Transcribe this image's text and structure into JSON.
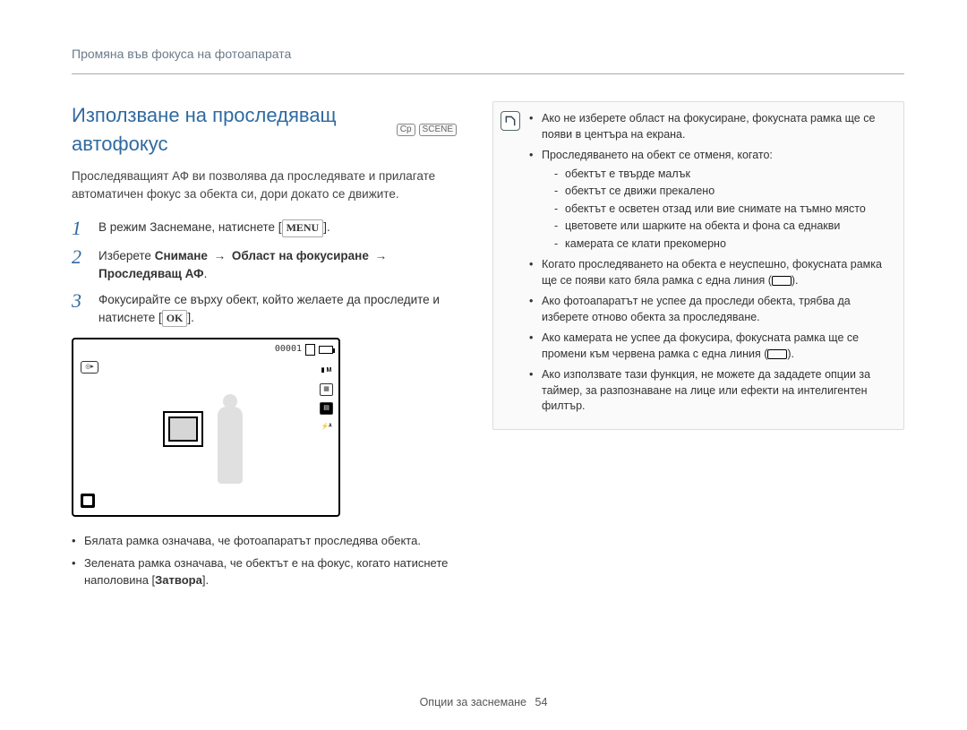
{
  "breadcrumb": "Промяна във фокуса на фотоапарата",
  "title": "Използване на проследяващ автофокус",
  "title_icons": {
    "a": "Cp",
    "b": "SCENE"
  },
  "intro": "Проследяващият АФ ви позволява да проследявате и прилагате автоматичен фокус за обекта си, дори докато се движите.",
  "steps": {
    "s1_pre": "В режим Заснемане, натиснете [",
    "s1_btn": "MENU",
    "s1_post": "].",
    "s2_pre": "Изберете ",
    "s2_b1": "Снимане",
    "s2_arrow": "→",
    "s2_b2": "Област на фокусиране",
    "s2_b3": "Проследяващ АФ",
    "s2_post": ".",
    "s3_pre": "Фокусирайте се върху обект, който желаете да проследите и натиснете [",
    "s3_btn": "OK",
    "s3_post": "]."
  },
  "display": {
    "counter": "00001"
  },
  "sub_bullets": {
    "b1_pre": "Бялата рамка означава, че фотоапаратът проследява обекта.",
    "b2_pre": "Зелената рамка означава, че обектът е на фокус, когато натиснете наполовина [",
    "b2_bold": "Затвора",
    "b2_post": "]."
  },
  "note": {
    "n1": "Ако не изберете област на фокусиране, фокусната рамка ще се появи в центъра на екрана.",
    "n2": "Проследяването на обект се отменя, когато:",
    "n2a": "обектът е твърде малък",
    "n2b": "обектът се движи прекалено",
    "n2c": "обектът е осветен отзад или вие снимате на тъмно място",
    "n2d": "цветовете или шарките на обекта и фона са еднакви",
    "n2e": "камерата се клати прекомерно",
    "n3_pre": "Когато проследяването на обекта е неуспешно, фокусната рамка ще се появи като бяла рамка с една линия (",
    "n3_post": ").",
    "n4": "Ако фотоапаратът не успее да проследи обекта, трябва да изберете отново обекта за проследяване.",
    "n5_pre": "Ако камерата не успее да фокусира, фокусната рамка ще се промени към червена рамка с една линия (",
    "n5_post": ").",
    "n6": "Ако използвате тази функция, не можете да зададете опции за таймер, за разпознаване на лице или ефекти на интелигентен филтър."
  },
  "footer": {
    "label": "Опции за заснемане",
    "page": "54"
  }
}
